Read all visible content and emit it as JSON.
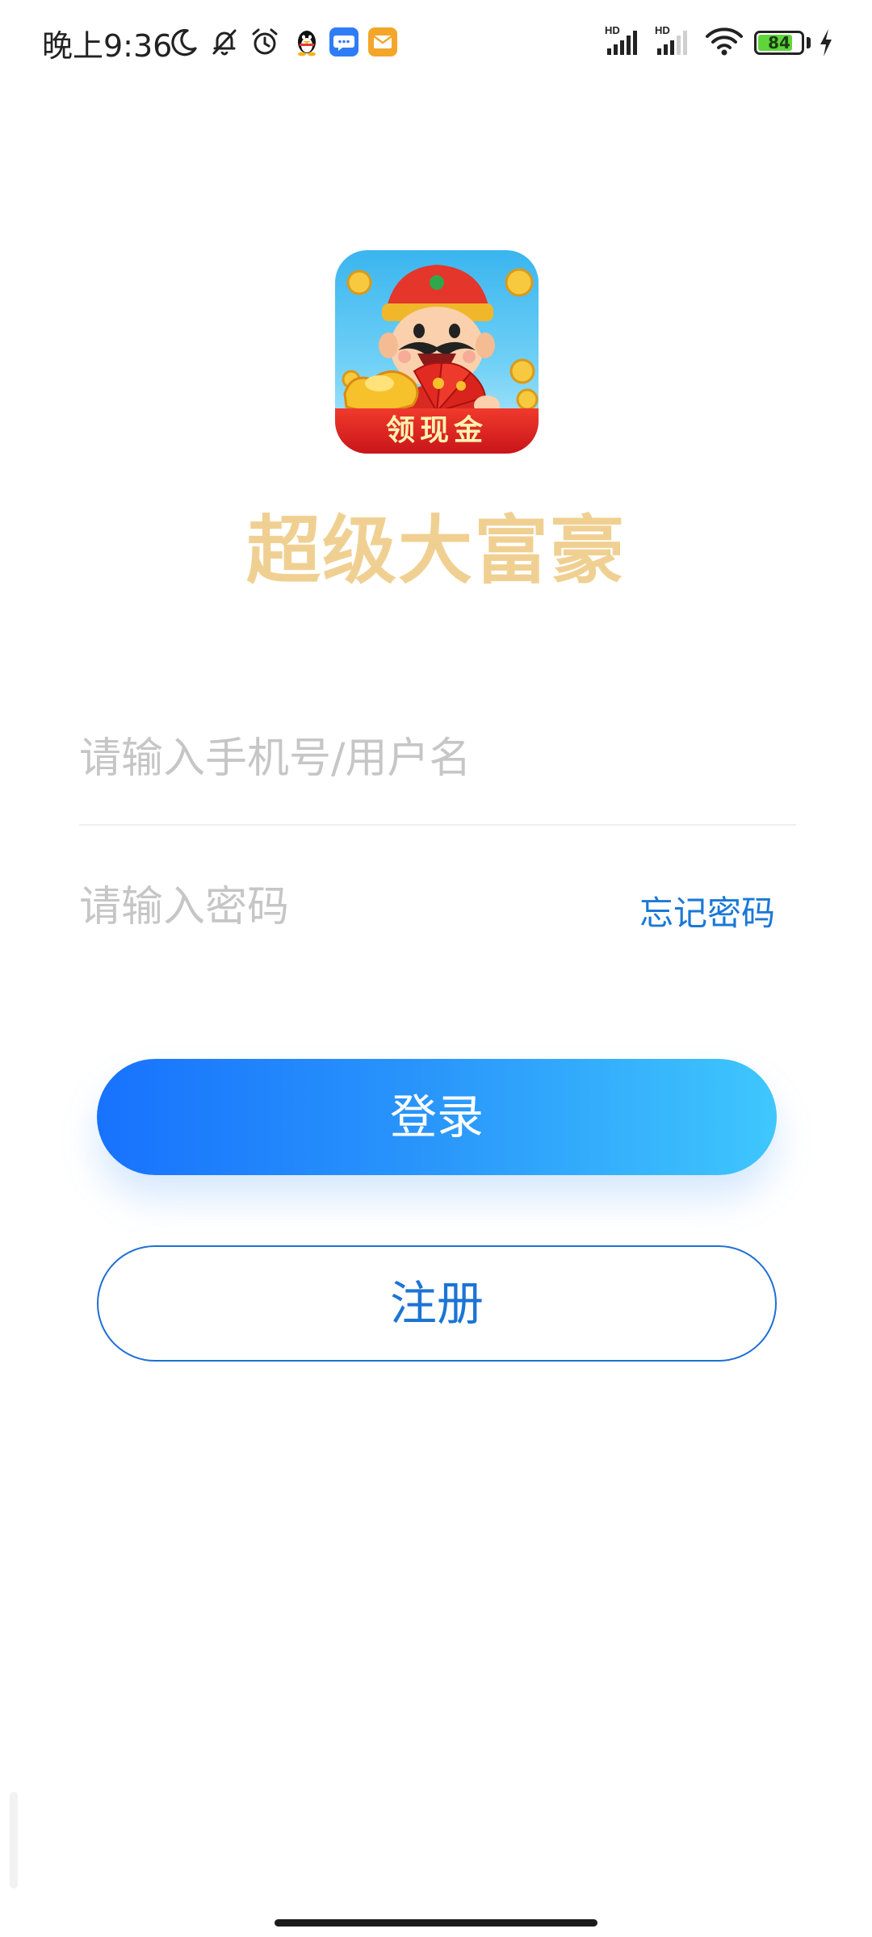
{
  "status_bar": {
    "time": "晚上9:36",
    "battery_level": "84",
    "battery_fraction": 0.84,
    "icons": [
      "moon-icon",
      "silent-bell-icon",
      "alarm-icon",
      "qq-penguin-icon",
      "message-app-icon",
      "mail-app-icon",
      "hd-signal-icon",
      "hd-signal-icon",
      "wifi-icon",
      "battery-icon",
      "charging-icon"
    ],
    "signal_labels": [
      "HD",
      "HD"
    ],
    "colors": {
      "message_app": "#2f7df6",
      "mail_app": "#f3a62a"
    }
  },
  "app": {
    "logo_banner": "领现金",
    "name": "超级大富豪"
  },
  "form": {
    "username_placeholder": "请输入手机号/用户名",
    "password_placeholder": "请输入密码",
    "forgot_password": "忘记密码"
  },
  "buttons": {
    "login": "登录",
    "register": "注册"
  },
  "colors": {
    "app_name": "#f0d092",
    "accent_blue": "#1a78d6",
    "login_gradient_start": "#1772fd",
    "login_gradient_end": "#3fc7fd"
  }
}
